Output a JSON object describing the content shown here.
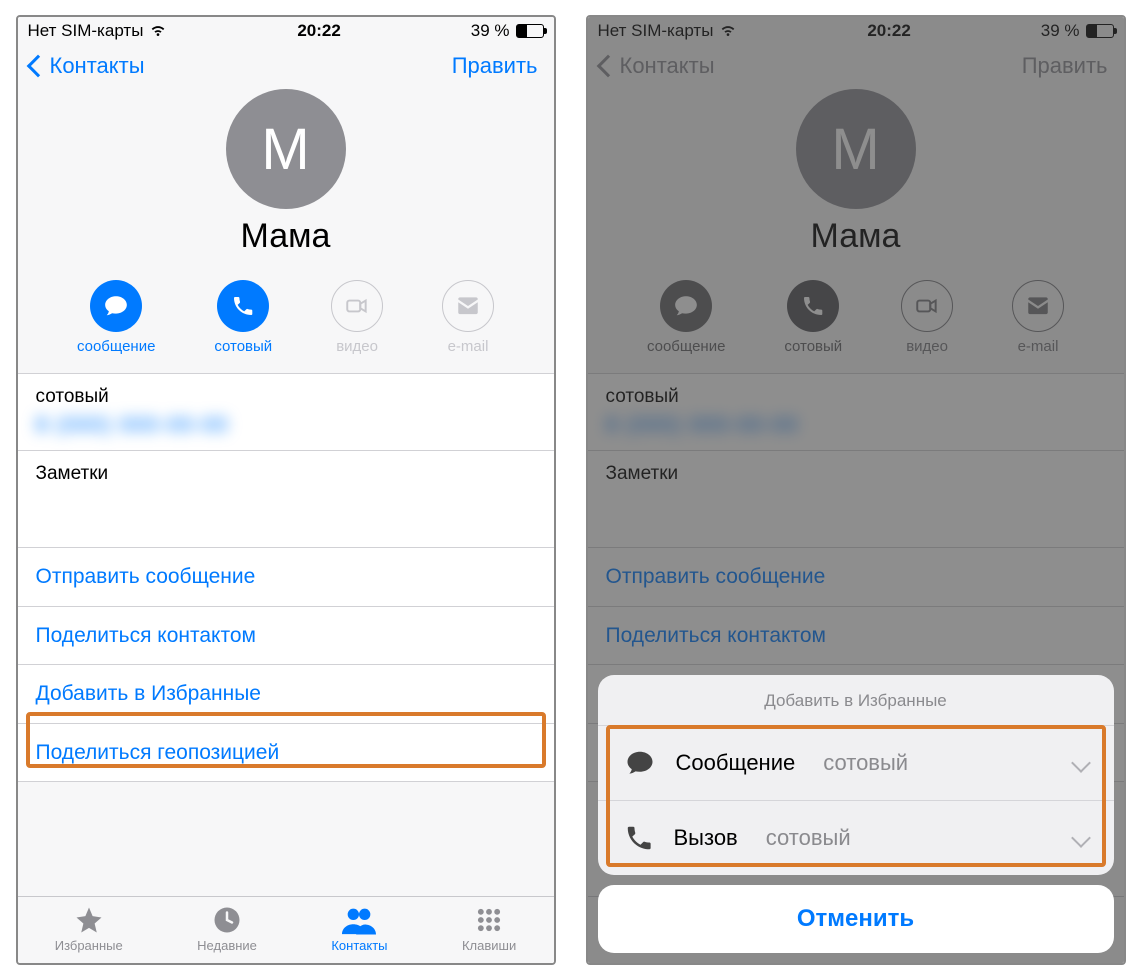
{
  "status": {
    "carrier": "Нет SIM-карты",
    "time": "20:22",
    "battery_pct": "39 %"
  },
  "nav": {
    "back": "Контакты",
    "edit": "Править"
  },
  "contact": {
    "initial": "М",
    "name": "Мама"
  },
  "actions": {
    "message": "сообщение",
    "mobile": "сотовый",
    "video": "видео",
    "email": "e-mail"
  },
  "fields": {
    "mobile_label": "сотовый",
    "mobile_number_blurred": "8 (000) 000-00-00",
    "notes_label": "Заметки"
  },
  "links": {
    "send_message": "Отправить сообщение",
    "share_contact": "Поделиться контактом",
    "add_favorite": "Добавить в Избранные",
    "share_location": "Поделиться геопозицией"
  },
  "tabs": {
    "favorites": "Избранные",
    "recents": "Недавние",
    "contacts": "Контакты",
    "keypad": "Клавиши"
  },
  "sheet": {
    "title": "Добавить в Избранные",
    "message": "Сообщение",
    "call": "Вызов",
    "sub": "сотовый",
    "cancel": "Отменить"
  }
}
